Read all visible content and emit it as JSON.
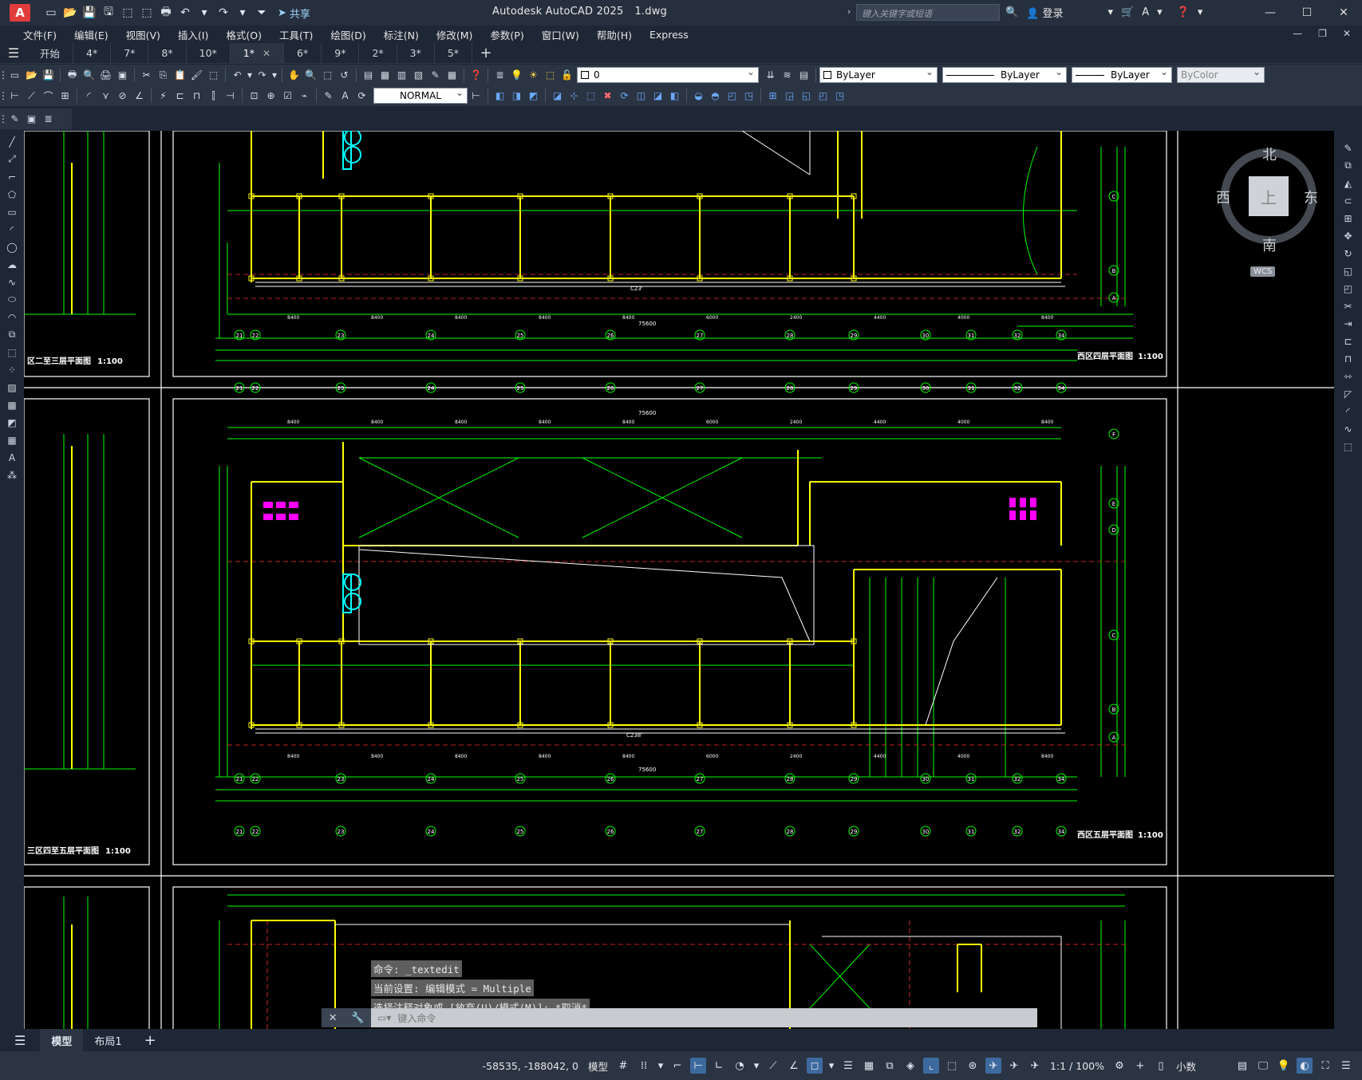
{
  "app": {
    "logo": "A",
    "title": "Autodesk AutoCAD 2025",
    "file": "1.dwg",
    "share_label": "共享",
    "search_placeholder": "键入关键字或短语",
    "login_label": "登录"
  },
  "menu": [
    "文件(F)",
    "编辑(E)",
    "视图(V)",
    "插入(I)",
    "格式(O)",
    "工具(T)",
    "绘图(D)",
    "标注(N)",
    "修改(M)",
    "参数(P)",
    "窗口(W)",
    "帮助(H)",
    "Express"
  ],
  "tabs": [
    {
      "label": "开始",
      "active": false
    },
    {
      "label": "4*",
      "active": false
    },
    {
      "label": "7*",
      "active": false
    },
    {
      "label": "8*",
      "active": false
    },
    {
      "label": "10*",
      "active": false
    },
    {
      "label": "1*",
      "active": true
    },
    {
      "label": "6*",
      "active": false
    },
    {
      "label": "9*",
      "active": false
    },
    {
      "label": "2*",
      "active": false
    },
    {
      "label": "3*",
      "active": false
    },
    {
      "label": "5*",
      "active": false
    }
  ],
  "toolbar": {
    "layer_value": "0",
    "color_value": "ByLayer",
    "linetype_value": "ByLayer",
    "lineweight_value": "ByLayer",
    "plotstyle_value": "ByColor",
    "textstyle_value": "NORMAL"
  },
  "viewcube": {
    "top": "上",
    "north": "北",
    "south": "南",
    "east": "东",
    "west": "西",
    "wcs": "WCS"
  },
  "drawing": {
    "title_top_left": "区二至三层平面图",
    "title_mid_left": "三区四至五层平面图",
    "title_top_right": "西区四层平面图",
    "title_mid_right": "西区五层平面图",
    "scale": "1:100",
    "dim_total": "75600",
    "axis_labels_bottom": [
      "21",
      "22",
      "23",
      "24",
      "25",
      "26",
      "27",
      "28",
      "29",
      "30",
      "31",
      "32",
      "34"
    ],
    "axis_labels_right": [
      "A",
      "B",
      "C",
      "D",
      "E",
      "F"
    ],
    "dims": [
      "8400",
      "8400",
      "8400",
      "8400",
      "8400",
      "6000",
      "2400",
      "4400",
      "4000",
      "8400"
    ],
    "corridor_label_top": "C23'",
    "corridor_label_mid": "C238'",
    "primary_color": "#00ff00",
    "wall_color": "#ffff00",
    "accent_color": "#00ffff",
    "text_color": "#ffffff",
    "magenta_color": "#ff00ff",
    "red_color": "#ff3030"
  },
  "command": {
    "history": [
      "命令: _textedit",
      "当前设置: 编辑模式 = Multiple",
      "选择注释对象或 [放弃(U)/模式(M)]: *取消*"
    ],
    "placeholder": "键入命令"
  },
  "layout_tabs": [
    {
      "label": "模型",
      "active": true
    },
    {
      "label": "布局1",
      "active": false
    }
  ],
  "status": {
    "coords": "-58535, -188042, 0",
    "model_label": "模型",
    "scale_label": "1:1 / 100%",
    "units_label": "小数"
  }
}
